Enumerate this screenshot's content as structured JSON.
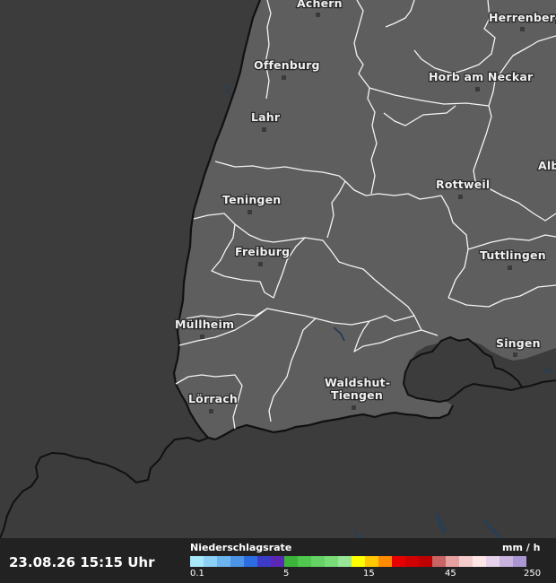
{
  "map": {
    "cities": [
      {
        "name": "Achern"
      },
      {
        "name": "Herrenberg"
      },
      {
        "name": "Offenburg"
      },
      {
        "name": "Horb am Neckar"
      },
      {
        "name": "Lahr"
      },
      {
        "name": "Alb"
      },
      {
        "name": "Rottweil"
      },
      {
        "name": "Teningen"
      },
      {
        "name": "Freiburg"
      },
      {
        "name": "Tuttlingen"
      },
      {
        "name": "Müllheim"
      },
      {
        "name": "Singen"
      },
      {
        "name": "Lörrach"
      },
      {
        "name": "Waldshut-",
        "line2": "Tiengen"
      }
    ]
  },
  "footer": {
    "timestamp": "23.08.26 15:15 Uhr",
    "legend_title": "Niederschlagsrate",
    "legend_unit": "mm / h",
    "legend_ticks": [
      "0.1",
      "5",
      "15",
      "45",
      "250"
    ],
    "legend_colors": [
      "#a8e8f8",
      "#8cd0f4",
      "#6cb4ee",
      "#4c94e6",
      "#2c6ee0",
      "#3c3cc8",
      "#5a28b4",
      "#3cb43c",
      "#50c850",
      "#64d264",
      "#78dc78",
      "#96e696",
      "#ffff00",
      "#ffc800",
      "#ff8c00",
      "#e60000",
      "#d20000",
      "#be0000",
      "#c86464",
      "#e6a0a0",
      "#f5cccc",
      "#ffe6e6",
      "#e6d2eb",
      "#c8b4dc",
      "#aa96d2"
    ]
  }
}
